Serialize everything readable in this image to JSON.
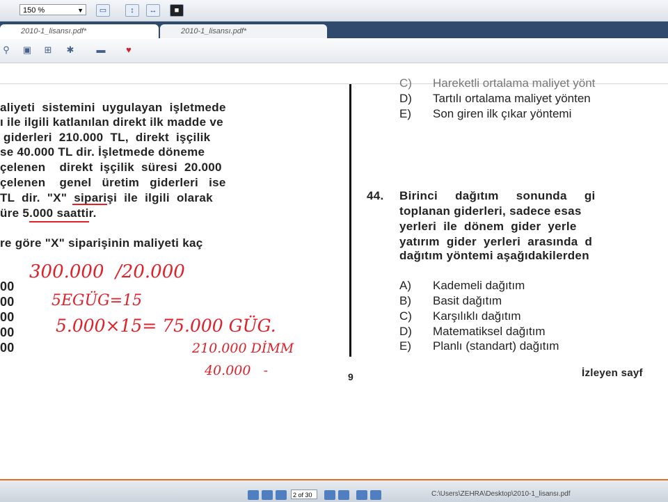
{
  "toolbar": {
    "zoom_value": "150 %"
  },
  "tabs": [
    {
      "label": "2010-1_lisansı.pdf*"
    },
    {
      "label": "2010-1_lisansı.pdf*"
    }
  ],
  "left_text": [
    "aliyeti  sistemini  uygulayan  işletmede",
    "ı ile ilgili katlanılan direkt ilk madde ve",
    " giderleri  210.000  TL,  direkt  işçilik",
    "se 40.000 TL dir. İşletmede döneme",
    "çelenen    direkt  işçilik  süresi  20.000",
    "çelenen    genel   üretim   giderleri   ise",
    "TL  dir.  \"X\"  siparişi  ile  ilgili  olarak",
    "üre 5.000 saattir."
  ],
  "left_question": "re göre \"X\" siparişinin maliyeti kaç",
  "left_answers": [
    "00",
    "00",
    "00",
    "00",
    "00"
  ],
  "handwriting": [
    "300.000  /20.000",
    "5EGÜG=15",
    "5.000×15= 75.000 GÜG.",
    "210.000 DİMM",
    "40.000   -"
  ],
  "page_number": "9",
  "prev_options": [
    {
      "letter": "C)",
      "text": "Hareketli ortalama maliyet yönt"
    },
    {
      "letter": "D)",
      "text": "Tartılı ortalama maliyet yönten"
    },
    {
      "letter": "E)",
      "text": "Son giren ilk çıkar yöntemi"
    }
  ],
  "q44": {
    "number": "44.",
    "lines": [
      "Birinci     dağıtım     sonunda     gi",
      "toplanan giderleri, sadece esas",
      "yerleri  ile  dönem  gider  yerle",
      "yatırım  gider  yerleri  arasında  d",
      "dağıtım yöntemi aşağıdakilerden"
    ],
    "options": [
      {
        "letter": "A)",
        "text": "Kademeli dağıtım"
      },
      {
        "letter": "B)",
        "text": "Basit dağıtım"
      },
      {
        "letter": "C)",
        "text": "Karşılıklı dağıtım"
      },
      {
        "letter": "D)",
        "text": "Matematiksel dağıtım"
      },
      {
        "letter": "E)",
        "text": "Planlı (standart) dağıtım"
      }
    ]
  },
  "next_page_hint": "İzleyen sayf",
  "statusbar": {
    "page_field": "2 of 30",
    "path": "C:\\Users\\ZEHRA\\Desktop\\2010-1_lisansı.pdf"
  },
  "colors": {
    "ink": "#e0202a",
    "status_accent": "#e07020"
  }
}
